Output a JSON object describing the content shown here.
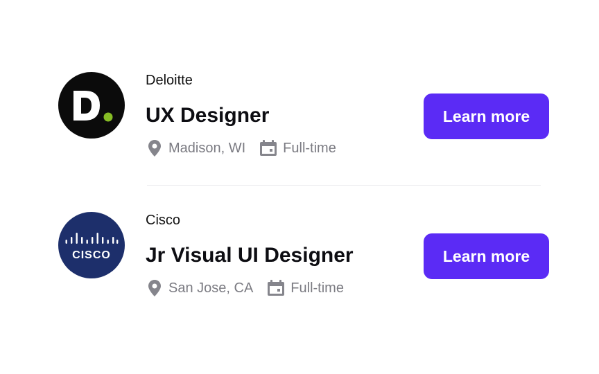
{
  "jobs": [
    {
      "company": "Deloitte",
      "logo_letter": "D",
      "logo_icon": "deloitte-logo",
      "title": "UX Designer",
      "location": "Madison, WI",
      "location_icon": "location-pin-icon",
      "type": "Full-time",
      "type_icon": "calendar-icon",
      "button_label": "Learn more"
    },
    {
      "company": "Cisco",
      "logo_text": "CISCO",
      "logo_icon": "cisco-logo",
      "title": "Jr Visual UI Designer",
      "location": "San Jose, CA",
      "location_icon": "location-pin-icon",
      "type": "Full-time",
      "type_icon": "calendar-icon",
      "button_label": "Learn more"
    }
  ],
  "colors": {
    "accent": "#5b2bf5",
    "deloitte_bg": "#0b0b0b",
    "deloitte_dot": "#86bc25",
    "cisco_bg": "#1d2f6b",
    "meta_text": "#7b7b82"
  }
}
